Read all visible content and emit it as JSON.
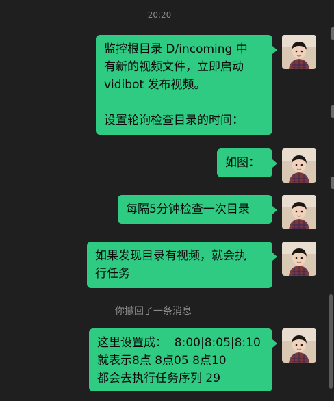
{
  "chat": {
    "timestamp": "20:20",
    "recall_notice": "你撤回了一条消息",
    "messages": [
      {
        "text": "监控根目录 D/incoming 中\n有新的视频文件，立即启动\nvidibot 发布视频。\n\n设置轮询检查目录的时间："
      },
      {
        "text": "如图："
      },
      {
        "text": "每隔5分钟检查一次目录"
      },
      {
        "text": "如果发现目录有视频，就会执\n行任务"
      },
      {
        "text": "这里设置成：  8:00|8:05|8:10\n就表示8点 8点05 8点10\n都会去执行任务序列 29"
      }
    ]
  },
  "colors": {
    "background": "#1f1f1f",
    "bubble_sent": "#2fcb83",
    "meta_text": "#8a8a8a"
  },
  "icons": {
    "avatar": "user-avatar-photo-icon"
  }
}
